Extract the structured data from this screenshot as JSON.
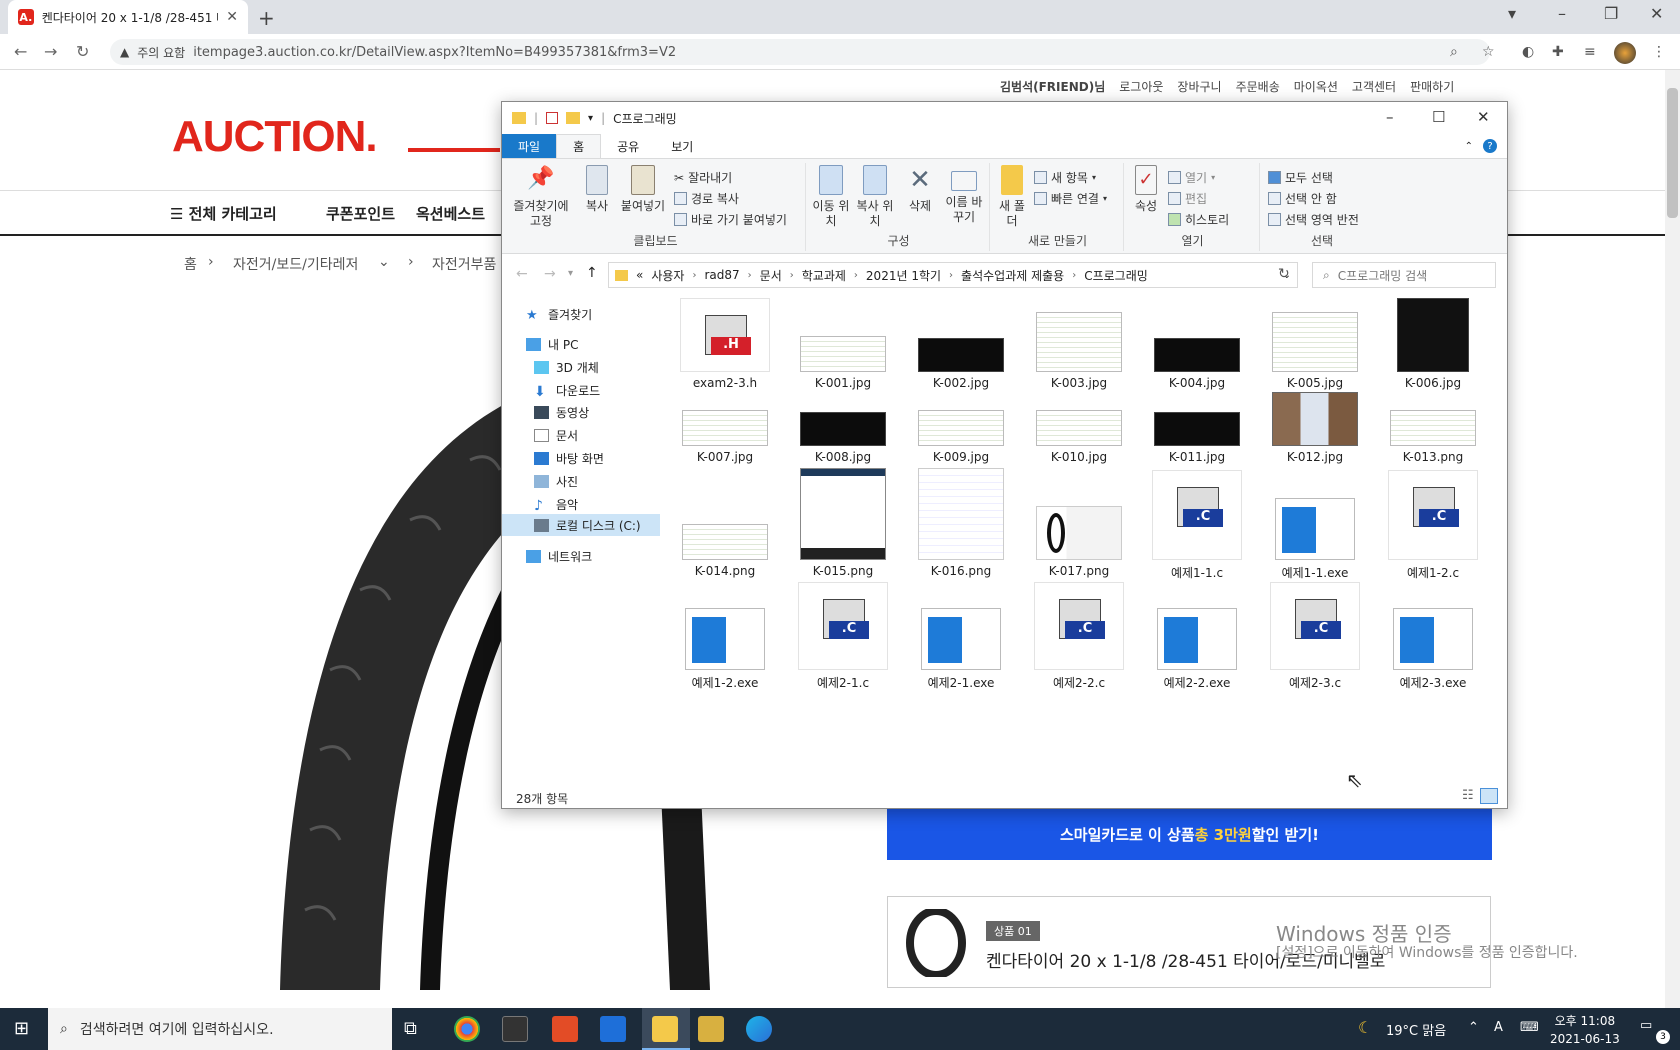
{
  "browser": {
    "tab_title": "켄다타이어 20 x 1-1/8 /28-451 타",
    "favicon_letter": "A.",
    "security_label": "주의 요함",
    "url": "itempage3.auction.co.kr/DetailView.aspx?ItemNo=B499357381&frm3=V2"
  },
  "site": {
    "user_links": [
      "김범석(FRIEND)님",
      "로그아웃",
      "장바구니",
      "주문배송",
      "마이옥션",
      "고객센터",
      "판매하기"
    ],
    "logo": "AUCTION.",
    "nav": [
      "전체 카테고리",
      "쿠폰포인트",
      "옥션베스트"
    ],
    "breadcrumb": [
      "홈",
      "자전거/보드/기타레저",
      "자전거부품"
    ],
    "banner_pre": "스마일카드로 이 상품 ",
    "banner_highlight": "총 3만원",
    "banner_post": " 할인 받기!",
    "product_badge": "상품 01",
    "product_name": "켄다타이어 20 x 1-1/8 /28-451 타이어/로드/미니벨로"
  },
  "activation": {
    "title": "Windows 정품 인증",
    "subtitle": "[설정]으로 이동하여 Windows를 정품 인증합니다."
  },
  "explorer": {
    "title": "C프로그래밍",
    "ribbon_tabs": [
      "파일",
      "홈",
      "공유",
      "보기"
    ],
    "groups": {
      "clipboard": {
        "label": "클립보드",
        "pin": "즐겨찾기에 고정",
        "copy": "복사",
        "paste": "붙여넣기",
        "cut": "잘라내기",
        "copy_path": "경로 복사",
        "paste_shortcut": "바로 가기 붙여넣기"
      },
      "organize": {
        "label": "구성",
        "move_to": "이동 위치",
        "copy_to": "복사 위치",
        "delete": "삭제",
        "rename": "이름 바꾸기"
      },
      "new": {
        "label": "새로 만들기",
        "new_folder": "새 폴더",
        "new_item": "새 항목",
        "easy_access": "빠른 연결"
      },
      "open": {
        "label": "열기",
        "properties": "속성",
        "open": "열기",
        "edit": "편집",
        "history": "히스토리"
      },
      "select": {
        "label": "선택",
        "select_all": "모두 선택",
        "select_none": "선택 안 함",
        "invert": "선택 영역 반전"
      }
    },
    "path": [
      "«",
      "사용자",
      "rad87",
      "문서",
      "학교과제",
      "2021년 1학기",
      "출석수업과제 제출용",
      "C프로그래밍"
    ],
    "search_placeholder": "C프로그래밍 검색",
    "nav": [
      "즐겨찾기",
      "내 PC",
      "3D 개체",
      "다운로드",
      "동영상",
      "문서",
      "바탕 화면",
      "사진",
      "음악",
      "로컬 디스크 (C:)",
      "네트워크"
    ],
    "files": [
      {
        "name": "exam2-3.h",
        "kind": "h"
      },
      {
        "name": "K-001.jpg",
        "kind": "code"
      },
      {
        "name": "K-002.jpg",
        "kind": "dark"
      },
      {
        "name": "K-003.jpg",
        "kind": "code"
      },
      {
        "name": "K-004.jpg",
        "kind": "dark"
      },
      {
        "name": "K-005.jpg",
        "kind": "code"
      },
      {
        "name": "K-006.jpg",
        "kind": "darktall"
      },
      {
        "name": "K-007.jpg",
        "kind": "code"
      },
      {
        "name": "K-008.jpg",
        "kind": "dark"
      },
      {
        "name": "K-009.jpg",
        "kind": "code"
      },
      {
        "name": "K-010.jpg",
        "kind": "code"
      },
      {
        "name": "K-011.jpg",
        "kind": "dark"
      },
      {
        "name": "K-012.jpg",
        "kind": "photo"
      },
      {
        "name": "K-013.png",
        "kind": "code"
      },
      {
        "name": "K-014.png",
        "kind": "code"
      },
      {
        "name": "K-015.png",
        "kind": "menu"
      },
      {
        "name": "K-016.png",
        "kind": "doc"
      },
      {
        "name": "K-017.png",
        "kind": "web"
      },
      {
        "name": "예제1-1.c",
        "kind": "c"
      },
      {
        "name": "예제1-1.exe",
        "kind": "exe"
      },
      {
        "name": "예제1-2.c",
        "kind": "c"
      },
      {
        "name": "예제1-2.exe",
        "kind": "exe"
      },
      {
        "name": "예제2-1.c",
        "kind": "c"
      },
      {
        "name": "예제2-1.exe",
        "kind": "exe"
      },
      {
        "name": "예제2-2.c",
        "kind": "c"
      },
      {
        "name": "예제2-2.exe",
        "kind": "exe"
      },
      {
        "name": "예제2-3.c",
        "kind": "c"
      },
      {
        "name": "예제2-3.exe",
        "kind": "exe"
      }
    ],
    "status": "28개 항목"
  },
  "taskbar": {
    "search_placeholder": "검색하려면 여기에 입력하십시오.",
    "weather": "19°C 맑음",
    "ime": "A",
    "time": "오후 11:08",
    "date": "2021-06-13",
    "notifications": "3"
  },
  "colors": {
    "accent": "#e1261c",
    "ribbon_file": "#1979ca",
    "banner": "#1a56e6",
    "taskbar": "#1c2b3a"
  }
}
